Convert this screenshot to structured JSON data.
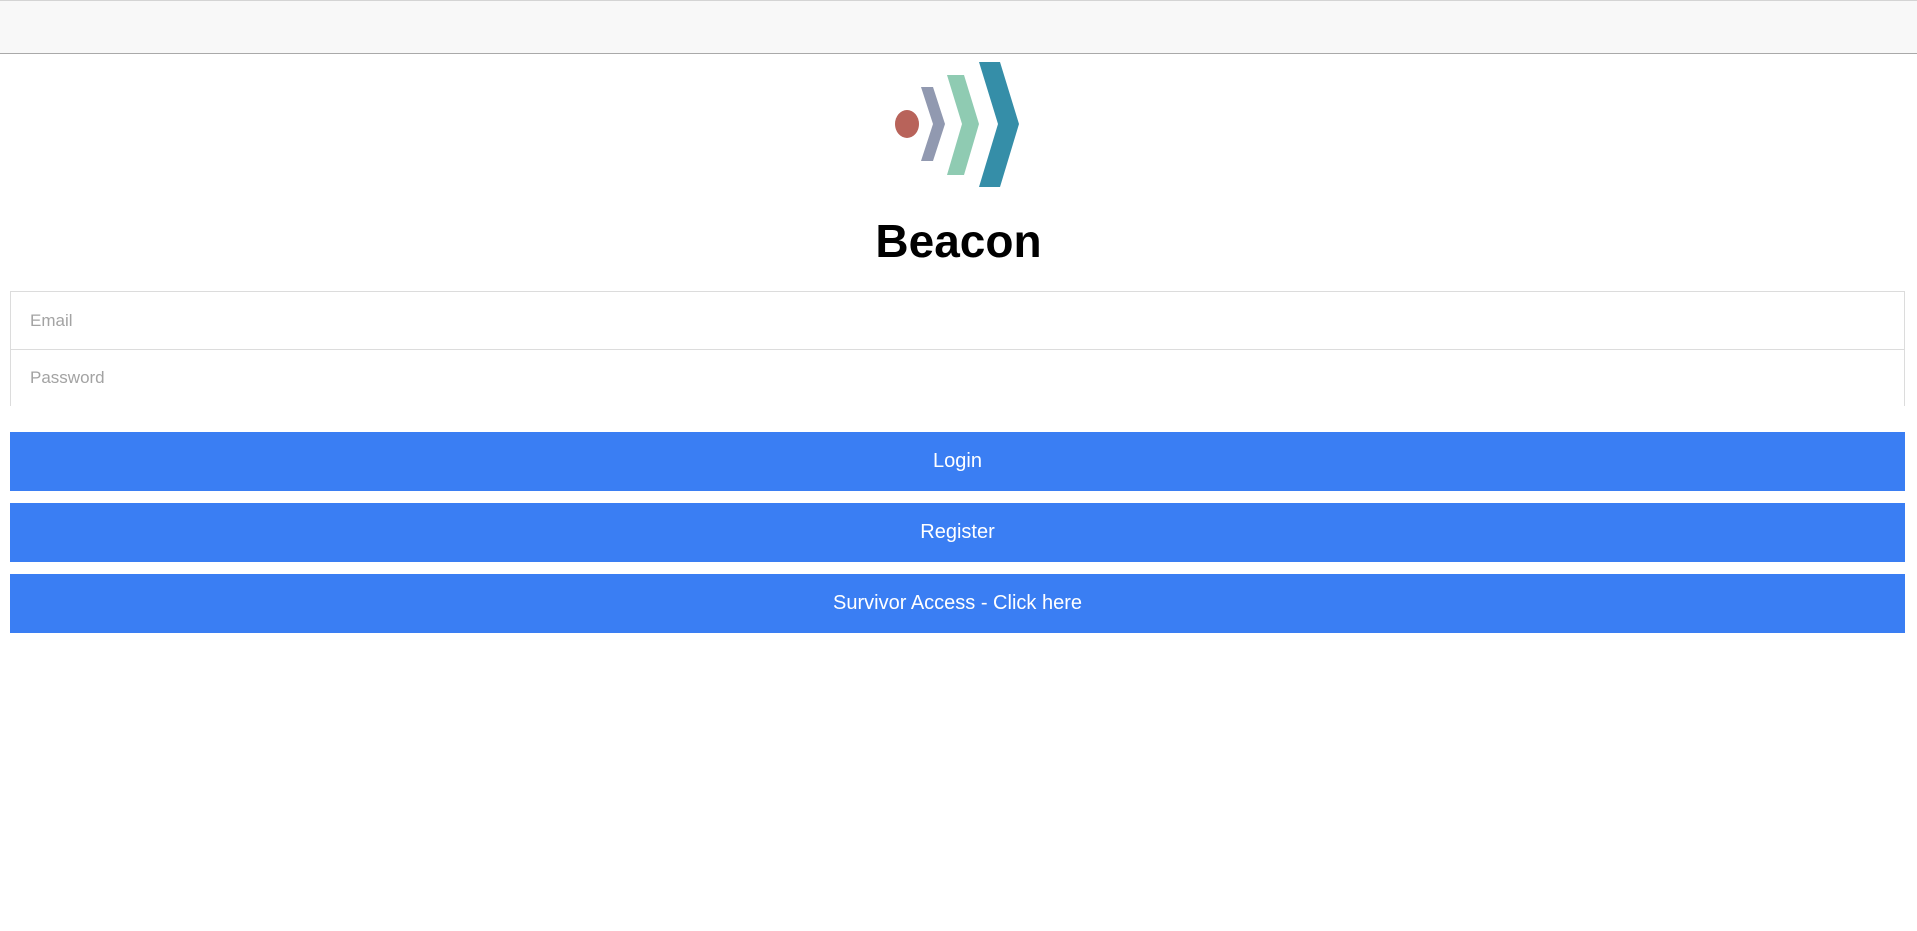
{
  "app": {
    "title": "Beacon"
  },
  "form": {
    "email_placeholder": "Email",
    "email_value": "",
    "password_placeholder": "Password",
    "password_value": ""
  },
  "buttons": {
    "login_label": "Login",
    "register_label": "Register",
    "survivor_label": "Survivor Access - Click here"
  },
  "colors": {
    "button_bg": "#3a7ef3",
    "logo_dot": "#b8635a",
    "logo_chevron_1": "#9199b0",
    "logo_chevron_2": "#8fcbb2",
    "logo_chevron_3": "#358ea8"
  },
  "icons": {
    "logo": "beacon-logo-icon"
  }
}
